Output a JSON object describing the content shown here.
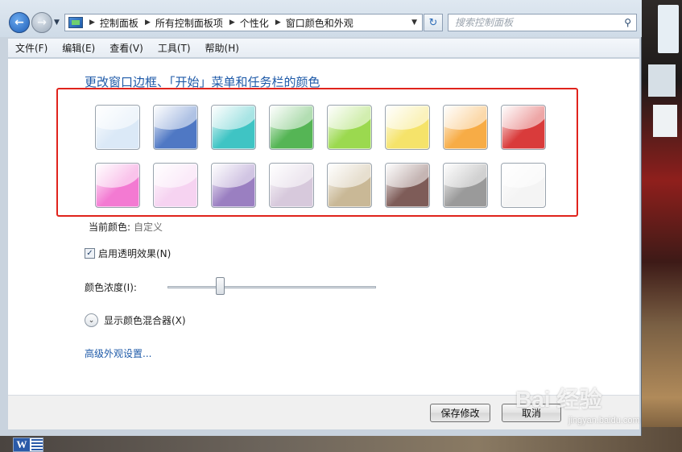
{
  "navigation": {
    "back_icon": "back-arrow-icon",
    "forward_icon": "forward-arrow-icon",
    "history_dropdown_icon": "chevron-down-icon"
  },
  "address_bar": {
    "icon": "control-panel-icon",
    "crumbs": [
      "控制面板",
      "所有控制面板项",
      "个性化",
      "窗口颜色和外观"
    ]
  },
  "search": {
    "placeholder": "搜索控制面板"
  },
  "menu": {
    "items": [
      "文件(F)",
      "编辑(E)",
      "查看(V)",
      "工具(T)",
      "帮助(H)"
    ]
  },
  "page": {
    "title": "更改窗口边框、「开始」菜单和任务栏的颜色",
    "swatches": [
      {
        "color": "#dbe9f7"
      },
      {
        "color": "#4f78c4"
      },
      {
        "color": "#3fc4c4"
      },
      {
        "color": "#55b555"
      },
      {
        "color": "#9bd94f"
      },
      {
        "color": "#f5e36a"
      },
      {
        "color": "#f7ac46"
      },
      {
        "color": "#d93b3b"
      },
      {
        "color": "#f37ad2"
      },
      {
        "color": "#f6d3f1"
      },
      {
        "color": "#9a7fc1"
      },
      {
        "color": "#d7c9dc"
      },
      {
        "color": "#c9b896"
      },
      {
        "color": "#7e5c58"
      },
      {
        "color": "#9a9a9a"
      },
      {
        "color": "#f4f4f4"
      }
    ],
    "current_color_label": "当前颜色:",
    "current_color_value": "自定义",
    "transparency_checkbox": {
      "label": "启用透明效果(N)",
      "checked": true
    },
    "intensity": {
      "label": "颜色浓度(I):",
      "value_fraction": 0.24
    },
    "mixer_label": "显示颜色混合器(X)",
    "advanced_link": "高级外观设置..."
  },
  "footer": {
    "save_label": "保存修改",
    "cancel_label": "取消"
  },
  "taskbar": {
    "word_app_letter": "W"
  },
  "watermark": {
    "main": "Bai  经验",
    "sub": "jingyan.baidu.com"
  },
  "colors": {
    "title_blue": "#1e5aa8",
    "highlight_red": "#e0231c"
  }
}
